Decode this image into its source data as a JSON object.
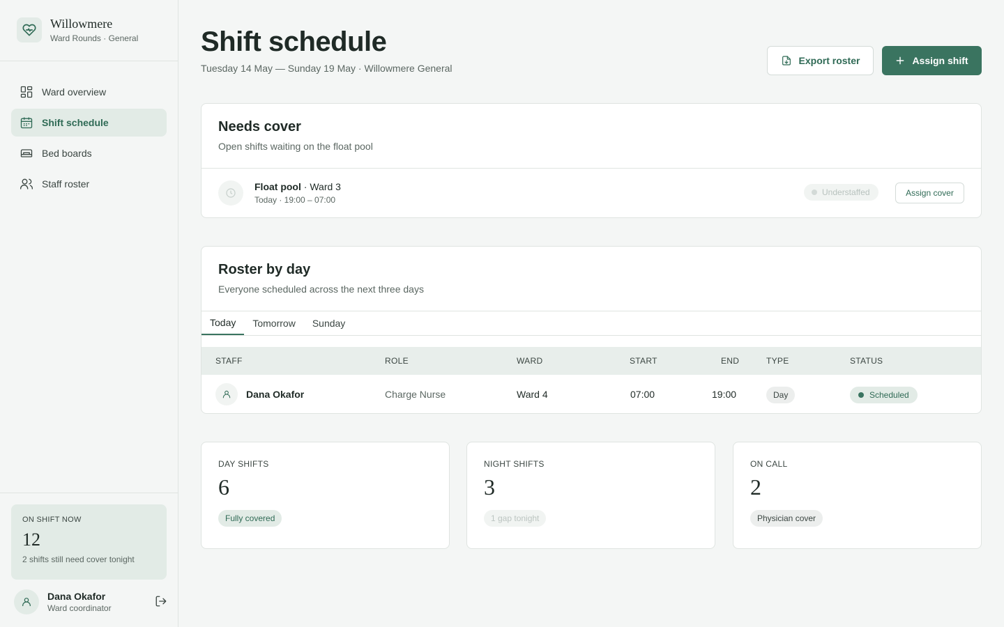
{
  "brand": {
    "name": "Willowmere",
    "subtitle": "Ward Rounds · General"
  },
  "nav": {
    "items": [
      {
        "label": "Ward overview",
        "icon": "grid-icon"
      },
      {
        "label": "Shift schedule",
        "icon": "calendar-icon",
        "active": true
      },
      {
        "label": "Bed boards",
        "icon": "bed-icon"
      },
      {
        "label": "Staff roster",
        "icon": "users-icon"
      }
    ]
  },
  "on_shift": {
    "label": "ON SHIFT NOW",
    "value": "12",
    "note": "2 shifts still need cover tonight"
  },
  "user": {
    "name": "Dana Okafor",
    "role": "Ward coordinator"
  },
  "header": {
    "title": "Shift schedule",
    "subtitle": "Tuesday 14 May — Sunday 19 May · Willowmere General",
    "export_label": "Export roster",
    "assign_label": "Assign shift"
  },
  "needs_cover": {
    "title": "Needs cover",
    "subtitle": "Open shifts waiting on the float pool",
    "item": {
      "pool": "Float pool",
      "ward": "· Ward 3",
      "time": "Today · 19:00 – 07:00",
      "status": "Understaffed",
      "action": "Assign cover"
    }
  },
  "roster": {
    "title": "Roster by day",
    "subtitle": "Everyone scheduled across the next three days",
    "tabs": [
      "Today",
      "Tomorrow",
      "Sunday"
    ],
    "columns": [
      "STAFF",
      "ROLE",
      "WARD",
      "START",
      "END",
      "TYPE",
      "STATUS"
    ],
    "rows": [
      {
        "staff": "Dana Okafor",
        "role": "Charge Nurse",
        "ward": "Ward 4",
        "start": "07:00",
        "end": "19:00",
        "type": "Day",
        "status": "Scheduled"
      }
    ]
  },
  "stats": [
    {
      "label": "DAY SHIFTS",
      "value": "6",
      "badge": "Fully covered"
    },
    {
      "label": "NIGHT SHIFTS",
      "value": "3",
      "badge": "1 gap tonight"
    },
    {
      "label": "ON CALL",
      "value": "2",
      "badge": "Physician cover"
    }
  ],
  "colors": {
    "accent": "#3a7460",
    "accent_soft": "#e2ebe6",
    "background": "#f4f6f5"
  }
}
